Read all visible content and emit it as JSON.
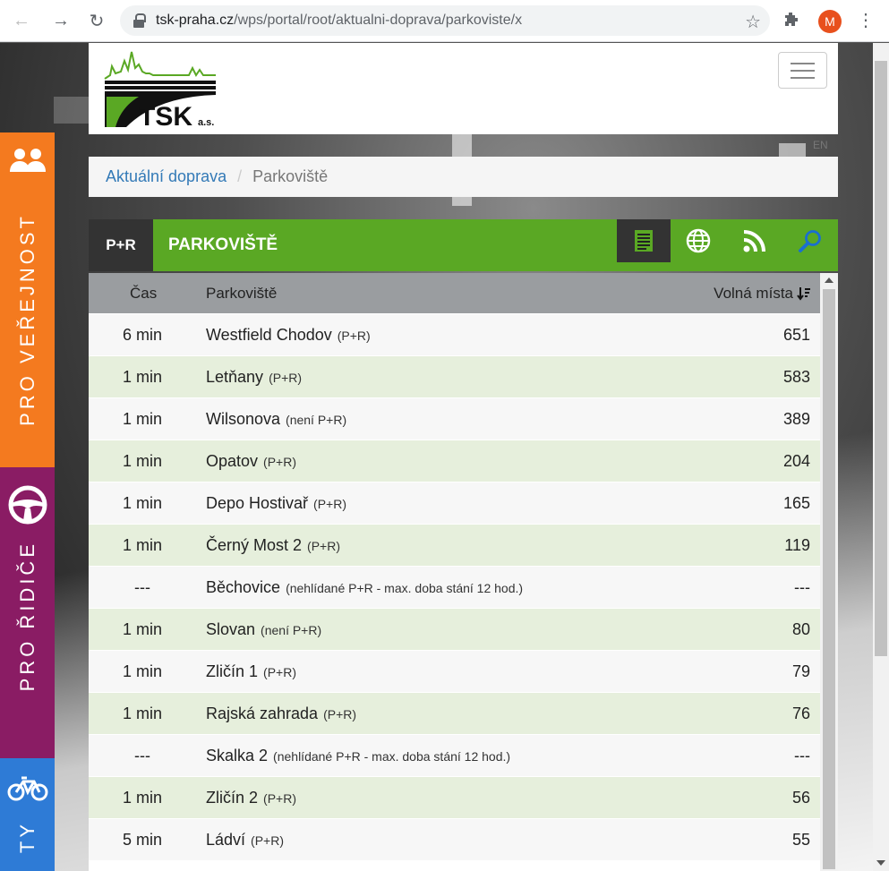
{
  "browser": {
    "url_host": "tsk-praha.cz",
    "url_path": "/wps/portal/root/aktualni-doprava/parkoviste/x",
    "avatar_letter": "M"
  },
  "side_tabs": [
    {
      "label": "PRO VEŘEJNOST",
      "icon": "people-icon",
      "color": "#f47a1f"
    },
    {
      "label": "PRO ŘIDIČE",
      "icon": "steering-wheel-icon",
      "color": "#8a1c64"
    },
    {
      "label": "TY",
      "icon": "bicycle-icon",
      "color": "#2e7bd6"
    }
  ],
  "header": {
    "logo_text": "TSK",
    "logo_suffix": "a.s.",
    "lang": "EN"
  },
  "breadcrumb": {
    "link": "Aktuální doprava",
    "separator": "/",
    "current": "Parkoviště"
  },
  "widget": {
    "badge": "P+R",
    "title": "PARKOVIŠTĚ",
    "buttons": [
      "list-icon",
      "globe-icon",
      "rss-icon",
      "search-icon"
    ]
  },
  "table": {
    "columns": {
      "time": "Čas",
      "name": "Parkoviště",
      "free": "Volná místa"
    },
    "rows": [
      {
        "time": "6 min",
        "name": "Westfield Chodov",
        "type": "(P+R)",
        "free": "651"
      },
      {
        "time": "1 min",
        "name": "Letňany",
        "type": "(P+R)",
        "free": "583"
      },
      {
        "time": "1 min",
        "name": "Wilsonova",
        "type": "(není P+R)",
        "free": "389"
      },
      {
        "time": "1 min",
        "name": "Opatov",
        "type": "(P+R)",
        "free": "204"
      },
      {
        "time": "1 min",
        "name": "Depo Hostivař",
        "type": "(P+R)",
        "free": "165"
      },
      {
        "time": "1 min",
        "name": "Černý Most 2",
        "type": "(P+R)",
        "free": "119"
      },
      {
        "time": "---",
        "name": "Běchovice",
        "type": "(nehlídané P+R - max. doba stání 12 hod.)",
        "free": "---"
      },
      {
        "time": "1 min",
        "name": "Slovan",
        "type": "(není P+R)",
        "free": "80"
      },
      {
        "time": "1 min",
        "name": "Zličín 1",
        "type": "(P+R)",
        "free": "79"
      },
      {
        "time": "1 min",
        "name": "Rajská zahrada",
        "type": "(P+R)",
        "free": "76"
      },
      {
        "time": "---",
        "name": "Skalka 2",
        "type": "(nehlídané P+R - max. doba stání 12 hod.)",
        "free": "---"
      },
      {
        "time": "1 min",
        "name": "Zličín 2",
        "type": "(P+R)",
        "free": "56"
      },
      {
        "time": "5 min",
        "name": "Ládví",
        "type": "(P+R)",
        "free": "55"
      }
    ]
  }
}
